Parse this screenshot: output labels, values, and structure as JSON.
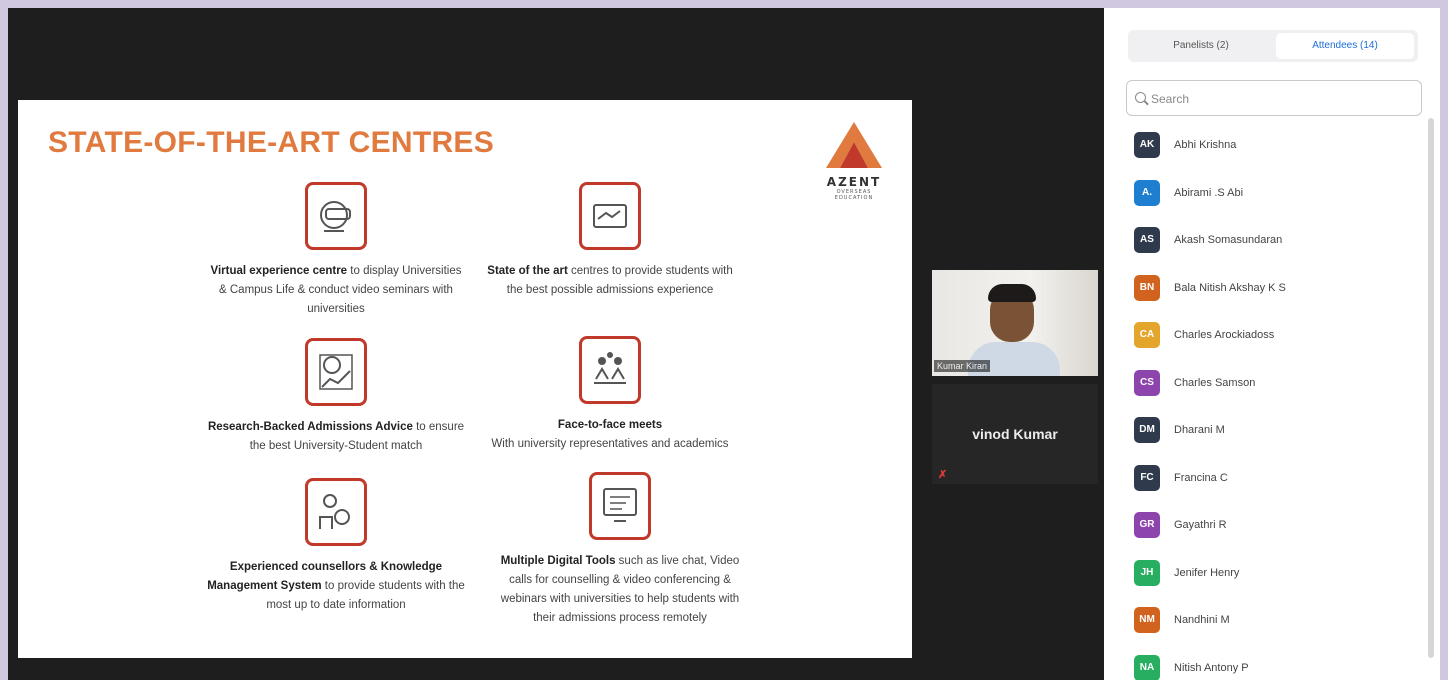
{
  "slide": {
    "title": "STATE-OF-THE-ART CENTRES",
    "logo": {
      "name": "AZENT",
      "subtitle_line1": "OVERSEAS",
      "subtitle_line2": "EDUCATION"
    },
    "features": [
      {
        "icon": "vr-headset-icon",
        "bold": "Virtual experience centre",
        "text": " to display Universities & Campus Life & conduct video seminars with universities"
      },
      {
        "icon": "handshake-icon",
        "bold": "State of the art",
        "text": " centres to provide students with the best possible admissions experience"
      },
      {
        "icon": "research-chart-icon",
        "bold": "Research-Backed Admissions Advice",
        "text": " to ensure the best University-Student match"
      },
      {
        "icon": "meeting-people-icon",
        "bold": "Face-to-face meets",
        "text": " With university representatives and academics"
      },
      {
        "icon": "counsellor-icon",
        "bold": "Experienced counsellors & Knowledge Management System",
        "text": " to provide students with the most up to date information"
      },
      {
        "icon": "digital-tools-icon",
        "bold": "Multiple Digital Tools",
        "text": " such as live chat, Video calls for counselling & video conferencing & webinars with universities to help students with their admissions process remotely"
      }
    ]
  },
  "video": {
    "tile_label": "Kumar Kiran",
    "nameplate_name": "vinod Kumar"
  },
  "panel": {
    "tabs": [
      {
        "label": "Panelists (2)"
      },
      {
        "label": "Attendees (14)"
      }
    ],
    "search_placeholder": "Search",
    "attendees": [
      {
        "initials": "AK",
        "name": "Abhi Krishna",
        "color": "#2f3b4c"
      },
      {
        "initials": "A.",
        "name": "Abirami .S Abi",
        "color": "#1e7fd1"
      },
      {
        "initials": "AS",
        "name": "Akash Somasundaran",
        "color": "#2f3b4c"
      },
      {
        "initials": "BN",
        "name": "Bala Nitish Akshay K S",
        "color": "#d1631f"
      },
      {
        "initials": "CA",
        "name": "Charles Arockiadoss",
        "color": "#e3a52b"
      },
      {
        "initials": "CS",
        "name": "Charles Samson",
        "color": "#8e44ad"
      },
      {
        "initials": "DM",
        "name": "Dharani M",
        "color": "#2f3b4c"
      },
      {
        "initials": "FC",
        "name": "Francina C",
        "color": "#2f3b4c"
      },
      {
        "initials": "GR",
        "name": "Gayathri R",
        "color": "#8e44ad"
      },
      {
        "initials": "JH",
        "name": "Jenifer Henry",
        "color": "#27ae60"
      },
      {
        "initials": "NM",
        "name": "Nandhini M",
        "color": "#d1631f"
      },
      {
        "initials": "NA",
        "name": "Nitish Antony P",
        "color": "#27ae60"
      }
    ]
  },
  "colors": {
    "accent": "#e07a3e",
    "icon_border": "#c0392b",
    "tab_active": "#1a6ed8"
  }
}
